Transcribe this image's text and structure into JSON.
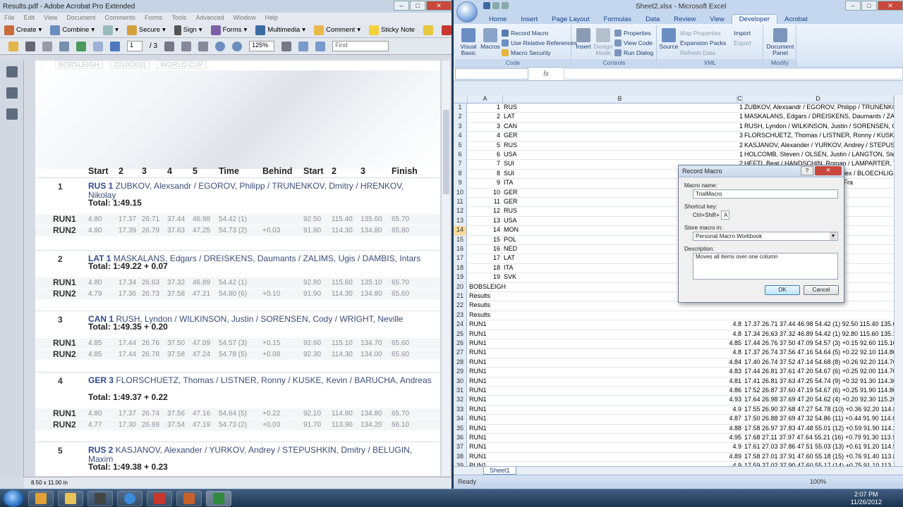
{
  "acrobat": {
    "title": "Results.pdf - Adobe Acrobat Pro Extended",
    "menu": [
      "File",
      "Edit",
      "View",
      "Document",
      "Comments",
      "Forms",
      "Tools",
      "Advanced",
      "Window",
      "Help"
    ],
    "toolbar": [
      "Create",
      "Combine",
      "",
      "Secure",
      "Sign",
      "Forms",
      "Multimedia",
      "Comment",
      "Sticky Note"
    ],
    "page_current": "1",
    "page_total": "/ 3",
    "zoom": "125%",
    "find_placeholder": "Find",
    "status": "8.50 x 11.00 in",
    "filters": [
      "BOBSLEIGH",
      "2010/2011",
      "WORLD CUP"
    ],
    "headers": [
      "Start",
      "2",
      "3",
      "4",
      "5",
      "Time",
      "Behind",
      "Start",
      "2",
      "3",
      "Finish"
    ],
    "entries": [
      {
        "rank": "1",
        "team": "RUS 1",
        "crew": "ZUBKOV, Alexsandr / EGOROV, Philipp / TRUNENKOV, Dmitry / HRENKOV, Nikolay",
        "total": "Total: 1:49.15",
        "run1": [
          "4.80",
          "17.37",
          "26.71",
          "37.44",
          "46.98",
          "54.42 (1)",
          "",
          "92.50",
          "115.40",
          "135.60",
          "65.70"
        ],
        "run2": [
          "4.80",
          "17.39",
          "26.79",
          "37.63",
          "47.25",
          "54.73 (2)",
          "+0.03",
          "91.80",
          "114.30",
          "134.80",
          "65.80"
        ]
      },
      {
        "rank": "2",
        "team": "LAT 1",
        "crew": "MASKALANS, Edgars / DREISKENS, Daumants / ZALIMS, Ugis / DAMBIS, Intars",
        "total": "Total: 1:49.22 + 0.07",
        "run1": [
          "4.80",
          "17.34",
          "26.63",
          "37.32",
          "46.89",
          "54.42 (1)",
          "",
          "92.80",
          "115.60",
          "135.10",
          "65.70"
        ],
        "run2": [
          "4.79",
          "17.36",
          "26.73",
          "37.58",
          "47.21",
          "54.80 (6)",
          "+0.10",
          "91.90",
          "114.30",
          "134.80",
          "65.60"
        ]
      },
      {
        "rank": "3",
        "team": "CAN 1",
        "crew": "RUSH, Lyndon / WILKINSON, Justin / SORENSEN, Cody / WRIGHT, Neville",
        "total": "Total: 1:49.35 + 0.20",
        "run1": [
          "4.85",
          "17.44",
          "26.76",
          "37.50",
          "47.09",
          "54.57 (3)",
          "+0.15",
          "92.60",
          "115.10",
          "134.70",
          "65.60"
        ],
        "run2": [
          "4.85",
          "17.44",
          "26.78",
          "37.58",
          "47.24",
          "54.78 (5)",
          "+0.08",
          "92.30",
          "114.30",
          "134.00",
          "65.60"
        ]
      },
      {
        "rank": "4",
        "team": "GER 3",
        "crew": "FLORSCHUETZ, Thomas / LISTNER, Ronny / KUSKE, Kevin / BARUCHA, Andreas",
        "total": "Total: 1:49.37 + 0.22",
        "run1": [
          "4.80",
          "17.37",
          "26.74",
          "37.56",
          "47.16",
          "54.64 (5)",
          "+0.22",
          "92.10",
          "114.80",
          "134.80",
          "65.70"
        ],
        "run2": [
          "4.77",
          "17.30",
          "26.69",
          "37.54",
          "47.19",
          "54.73 (2)",
          "+0.03",
          "91.70",
          "113.90",
          "134.20",
          "66.10"
        ]
      },
      {
        "rank": "5",
        "team": "RUS 2",
        "crew": "KASJANOV, Alexander / YURKOV, Andrey / STEPUSHKIN, Dmitry / BELUGIN, Maxim",
        "total": "Total: 1:49.38 + 0.23"
      }
    ],
    "run1_label": "RUN1",
    "run2_label": "RUN2"
  },
  "excel": {
    "title": "Sheet2.xlsx - Microsoft Excel",
    "tabs": [
      "Home",
      "Insert",
      "Page Layout",
      "Formulas",
      "Data",
      "Review",
      "View",
      "Developer",
      "Acrobat"
    ],
    "active_tab": "Developer",
    "code": {
      "visual_basic": "Visual Basic",
      "macros": "Macros",
      "record": "Record Macro",
      "relative": "Use Relative References",
      "security": "Macro Security",
      "group": "Code"
    },
    "controls": {
      "insert": "Insert",
      "design": "Design Mode",
      "properties": "Properties",
      "view_code": "View Code",
      "run_dialog": "Run Dialog",
      "group": "Controls"
    },
    "xml": {
      "source": "Source",
      "map_props": "Map Properties",
      "expansion": "Expansion Packs",
      "refresh": "Refresh Data",
      "import": "Import",
      "export": "Export",
      "group": "XML"
    },
    "modify": {
      "doc_panel": "Document Panel",
      "group": "Modify"
    },
    "fx": "fx",
    "columns": [
      "A",
      "B",
      "C",
      "D"
    ],
    "rows": [
      [
        "1",
        "1",
        "RUS",
        "1",
        "ZUBKOV, Alexsandr / EGOROV, Philipp / TRUNENKOV"
      ],
      [
        "2",
        "2",
        "LAT",
        "1",
        "MASKALANS, Edgars / DREISKENS, Daumants / ZALIM"
      ],
      [
        "3",
        "3",
        "CAN",
        "1",
        "RUSH, Lyndon / WILKINSON, Justin / SORENSEN, Co"
      ],
      [
        "4",
        "4",
        "GER",
        "3",
        "FLORSCHUETZ, Thomas / LISTNER, Ronny / KUSKE, K"
      ],
      [
        "5",
        "5",
        "RUS",
        "2",
        "KASJANOV, Alexander / YURKOV, Andrey / STEPUSH"
      ],
      [
        "6",
        "6",
        "USA",
        "1",
        "HOLCOMB, Steven / OLSEN, Justin / LANGTON, Stev"
      ],
      [
        "7",
        "7",
        "SUI",
        "2",
        "HEFTI, Beat / HANDSCHIN, Roman / LAMPARTER, The"
      ],
      [
        "8",
        "8",
        "SUI",
        "1",
        "BAUMANN, Gregor / BAUMANN, Alex / BLOECHLIGE"
      ],
      [
        "9",
        "9",
        "ITA",
        "1",
        "BERTAZZO, Simone / ... / COSTA, Fra"
      ],
      [
        "10",
        "10",
        "GER",
        "",
        "er / ... / "
      ],
      [
        "11",
        "11",
        "GER",
        "",
        "/ BECKE, Florian"
      ],
      [
        "12",
        "12",
        "RUS",
        "",
        "/ PAETZOLD, M"
      ],
      [
        "13",
        "13",
        "USA",
        "",
        "ov, Denis / SE"
      ],
      [
        "14",
        "14",
        "MON",
        "",
        "ANDRACSEK, La"
      ],
      [
        "15",
        "15",
        "POL",
        "",
        "/ BROWN, Lasc"
      ],
      [
        "16",
        "16",
        "NED",
        "",
        "ichal / NIEWIAR"
      ],
      [
        "17",
        "17",
        "LAT",
        "",
        "aar / JANSMA, Sy"
      ],
      [
        "18",
        "18",
        "ITA",
        "",
        "/ ARHIPOVS, Mik"
      ],
      [
        "19",
        "19",
        "SVK",
        "",
        "Danilo / COMEL"
      ],
      [
        "20",
        "BOBSLEIGH",
        "",
        "",
        "/ BICIAN, Andre"
      ],
      [
        "21",
        "Results",
        "",
        "",
        ""
      ],
      [
        "22",
        "Results",
        "",
        "",
        ""
      ],
      [
        "23",
        "Results",
        "",
        "",
        ""
      ],
      [
        "24",
        "RUN1",
        "",
        "4.8",
        "17.37 26.71 37.44 46.98 54.42 (1) 92.50 115.40 135.60"
      ],
      [
        "25",
        "RUN1",
        "",
        "4.8",
        "17.34 26.63 37.32 46.89 54.42 (1) 92.80 115.60 135.10"
      ],
      [
        "26",
        "RUN1",
        "",
        "4.85",
        "17.44 26.76 37.50 47.09 54.57 (3) +0.15 92.60 115.10"
      ],
      [
        "27",
        "RUN1",
        "",
        "4.8",
        "17.37 26.74 37.56 47.16 54.64 (5) +0.22 92.10 114.80"
      ],
      [
        "28",
        "RUN1",
        "",
        "4.84",
        "17.40 26.74 37.52 47.14 54.68 (8) +0.26 92.20 114.70"
      ],
      [
        "29",
        "RUN1",
        "",
        "4.83",
        "17.44 26.81 37.61 47.20 54.67 (6) +0.25 92.00 114.70"
      ],
      [
        "30",
        "RUN1",
        "",
        "4.81",
        "17.41 26.81 37.63 47.25 54.74 (9) +0.32 91.30 114.30"
      ],
      [
        "31",
        "RUN1",
        "",
        "4.86",
        "17.52 26.87 37.60 47.19 54.67 (6) +0.25 91.90 114.80"
      ],
      [
        "32",
        "RUN1",
        "",
        "4.93",
        "17.64 26.98 37.69 47.20 54.62 (4) +0.20 92.30 115.20"
      ],
      [
        "33",
        "RUN1",
        "",
        "4.9",
        "17.55 26.90 37.68 47.27 54.78 (10) +0.36 92.20 114.80"
      ],
      [
        "34",
        "RUN1",
        "",
        "4.87",
        "17.50 26.88 37.69 47.32 54.86 (11) +0.44 91.90 114.60"
      ],
      [
        "35",
        "RUN1",
        "",
        "4.88",
        "17.58 26.97 37.83 47.48 55.01 (12) +0.59 91.90 114.20"
      ],
      [
        "36",
        "RUN1",
        "",
        "4.95",
        "17.68 27.11 37.97 47.64 55.21 (16) +0.79 91.30 113.90"
      ],
      [
        "37",
        "RUN1",
        "",
        "4.9",
        "17.61 27.03 37.86 47.51 55.03 (13) +0.61 91.20 114.50"
      ],
      [
        "38",
        "RUN1",
        "",
        "4.89",
        "17.58 27.01 37.91 47.60 55.18 (15) +0.76 91.40 113.80"
      ],
      [
        "39",
        "RUN1",
        "",
        "4.9",
        "17.59 27.02 37.90 47.60 55.17 (14) +0.75 91.10 113.70"
      ],
      [
        "40",
        "RUN1",
        "",
        "4.81",
        "17.46 26.94 37.79 47.62 55.22 (17) +0.80 90.60 113.40"
      ]
    ],
    "sheet_tab": "Sheet1",
    "status": "Ready",
    "zoom": "100%"
  },
  "dialog": {
    "title": "Record Macro",
    "help": "?",
    "name_label": "Macro name:",
    "name_value": "TrialMacro",
    "shortcut_label": "Shortcut key:",
    "shortcut_prefix": "Ctrl+Shift+",
    "shortcut_value": "A",
    "store_label": "Store macro in:",
    "store_value": "Personal Macro Workbook",
    "desc_label": "Description:",
    "desc_value": "Moves all items over one column",
    "ok": "OK",
    "cancel": "Cancel"
  },
  "taskbar": {
    "time": "2:07 PM",
    "date": "11/26/2012"
  }
}
